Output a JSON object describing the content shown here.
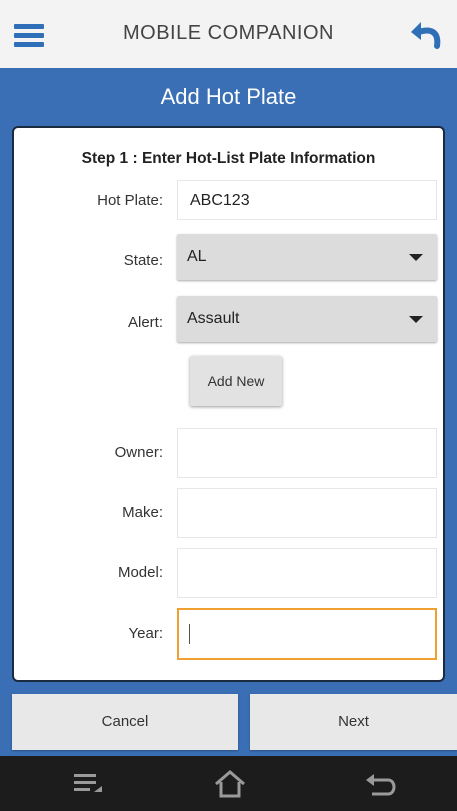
{
  "app": {
    "title": "MOBILE COMPANION",
    "screen_title": "Add Hot Plate"
  },
  "form": {
    "step_title": "Step 1 : Enter Hot-List Plate Information",
    "hot_plate": {
      "label": "Hot Plate:",
      "value": "ABC123"
    },
    "state": {
      "label": "State:",
      "value": "AL"
    },
    "alert": {
      "label": "Alert:",
      "value": "Assault"
    },
    "add_new_label": "Add New",
    "owner": {
      "label": "Owner:",
      "value": ""
    },
    "make": {
      "label": "Make:",
      "value": ""
    },
    "model": {
      "label": "Model:",
      "value": ""
    },
    "year": {
      "label": "Year:",
      "value": ""
    }
  },
  "actions": {
    "cancel_label": "Cancel",
    "next_label": "Next"
  },
  "icons": {
    "menu": "menu-icon",
    "back": "back-arrow-icon",
    "nav_menu": "recent-apps-icon",
    "nav_home": "home-icon",
    "nav_back": "back-icon"
  },
  "colors": {
    "primary": "#3a6fb5",
    "accent_focus": "#f0a030",
    "nav_bar": "#1c1c1c"
  }
}
